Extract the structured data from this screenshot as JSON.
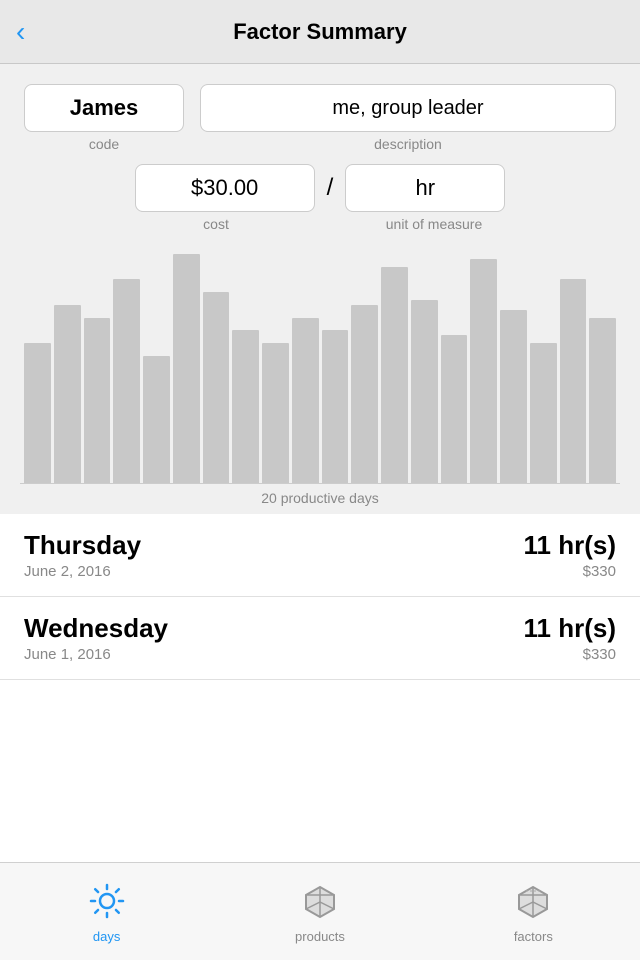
{
  "header": {
    "title": "Factor Summary",
    "back_label": "‹"
  },
  "fields": {
    "code": "James",
    "code_label": "code",
    "description": "me, group leader",
    "description_label": "description",
    "cost": "$30.00",
    "cost_label": "cost",
    "slash": "/",
    "uom": "hr",
    "uom_label": "unit of measure"
  },
  "chart": {
    "label": "20 productive days",
    "bars": [
      55,
      70,
      65,
      80,
      50,
      90,
      75,
      60,
      55,
      65,
      60,
      70,
      85,
      72,
      58,
      88,
      68,
      55,
      80,
      65
    ]
  },
  "list_items": [
    {
      "day": "Thursday",
      "date": "June 2, 2016",
      "hours": "11 hr(s)",
      "cost": "$330"
    },
    {
      "day": "Wednesday",
      "date": "June 1, 2016",
      "hours": "11 hr(s)",
      "cost": "$330"
    }
  ],
  "tabs": [
    {
      "id": "days",
      "label": "days",
      "active": true
    },
    {
      "id": "products",
      "label": "products",
      "active": false
    },
    {
      "id": "factors",
      "label": "factors",
      "active": false
    }
  ]
}
